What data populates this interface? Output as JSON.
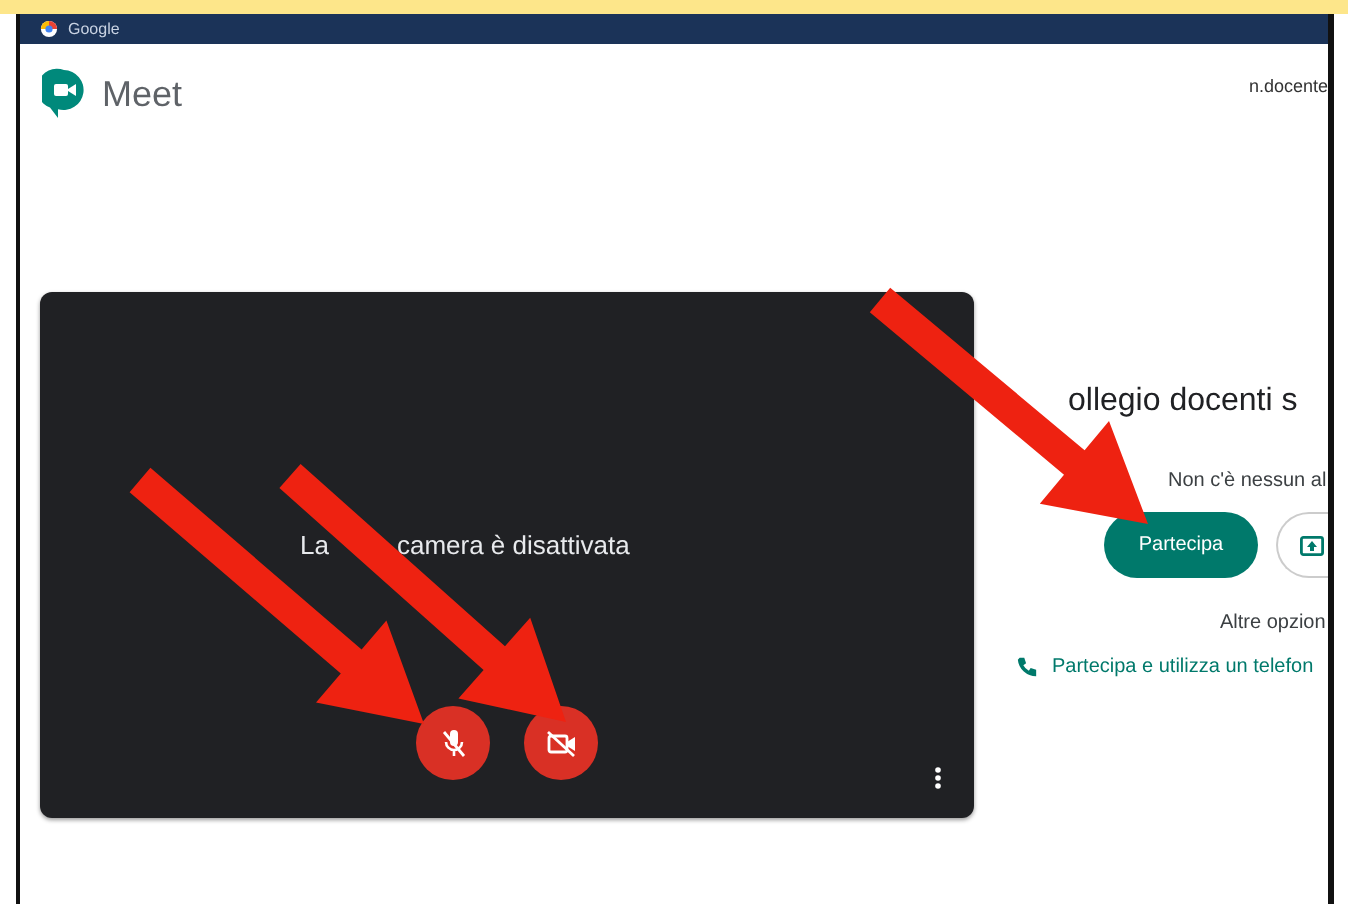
{
  "browser_tab": {
    "title": "Google"
  },
  "header": {
    "app_name": "Meet",
    "account": "n.docente"
  },
  "preview": {
    "message_parts": [
      "La",
      "camera è disattivata"
    ],
    "microphone_on": false,
    "camera_on": false
  },
  "join": {
    "meeting_title": "ollegio docenti s",
    "status": "Non c'è nessun al",
    "join_button": "Partecipa",
    "more_options": "Altre opzion",
    "phone_link": "Partecipa e utilizza un telefon"
  }
}
